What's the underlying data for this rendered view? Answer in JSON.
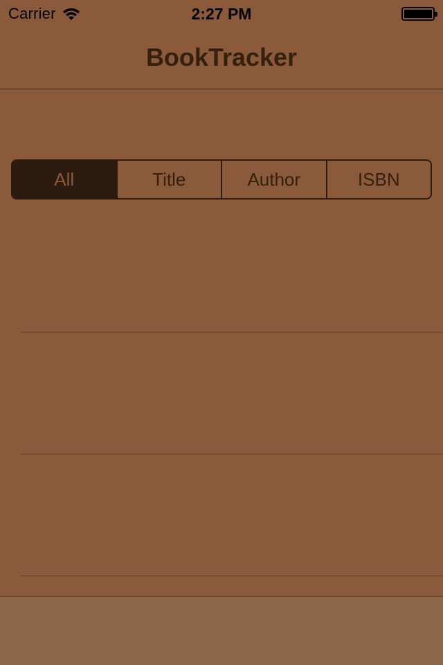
{
  "status_bar": {
    "carrier": "Carrier",
    "time": "2:27 PM",
    "icons": [
      "wifi-icon",
      "battery-icon"
    ]
  },
  "nav": {
    "title": "BookTracker"
  },
  "segmented_control": {
    "selected": "All",
    "segments": [
      "All",
      "Title",
      "Author",
      "ISBN"
    ]
  },
  "colors": {
    "background": "#8a5a3a",
    "accent_dark": "#2e1b10",
    "text": "#35200f",
    "toolbar": "#8c6649"
  }
}
